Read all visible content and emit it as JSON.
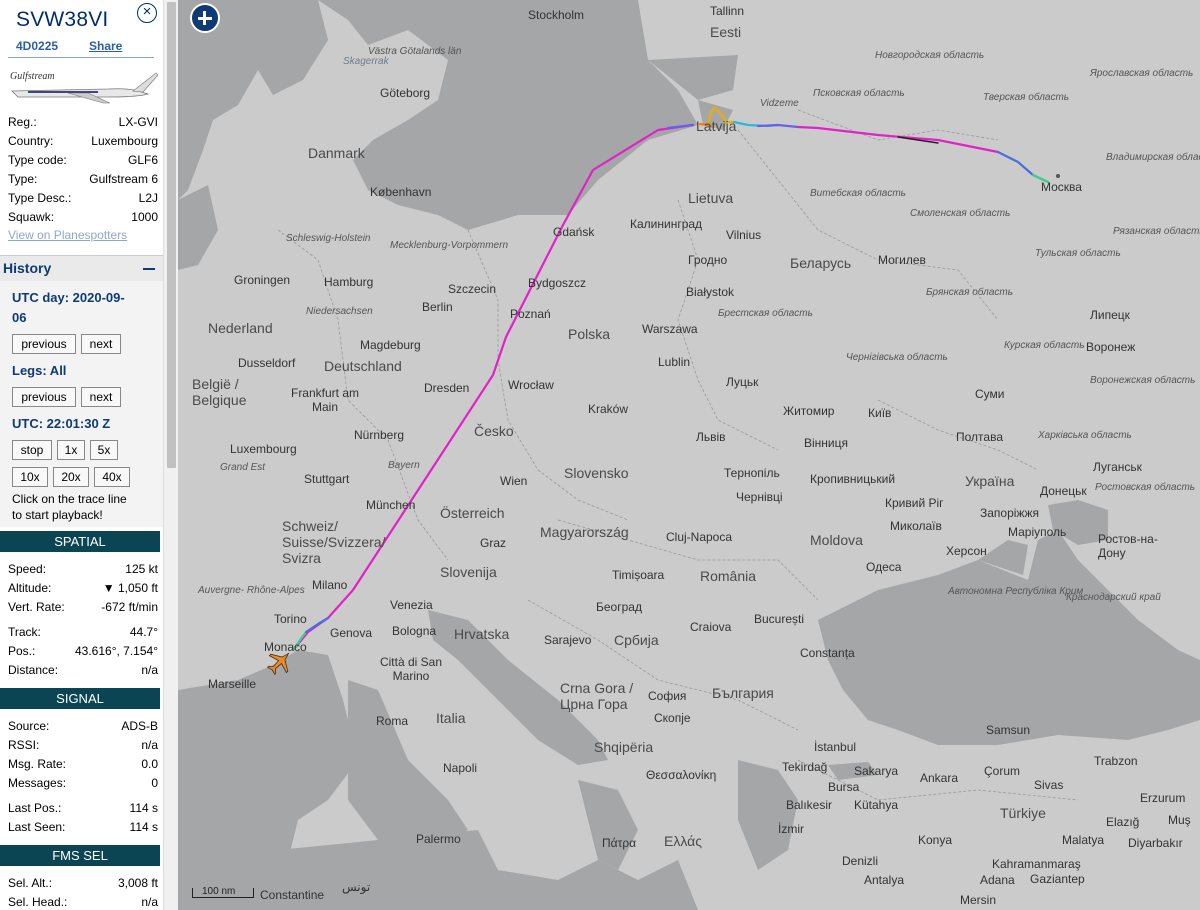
{
  "aircraft": {
    "callsign": "SVW38VI",
    "hex": "4D0225",
    "share_label": "Share",
    "close_icon": "close-icon",
    "photo_brand": "Gulfstream",
    "details": [
      {
        "key": "Reg.:",
        "value": "LX-GVI"
      },
      {
        "key": "Country:",
        "value": "Luxembourg"
      },
      {
        "key": "Type code:",
        "value": "GLF6"
      },
      {
        "key": "Type:",
        "value": "Gulfstream 6"
      },
      {
        "key": "Type Desc.:",
        "value": "L2J"
      },
      {
        "key": "Squawk:",
        "value": "1000"
      }
    ],
    "planespotters_link": "View on Planespotters"
  },
  "history": {
    "title": "History",
    "utc_day": "UTC day: 2020-09-",
    "utc_day_cont": "06",
    "prev_label": "previous",
    "next_label": "next",
    "legs": "Legs: All",
    "utc_time": "UTC: 22:01:30 Z",
    "speed_buttons": [
      "stop",
      "1x",
      "5x",
      "10x",
      "20x",
      "40x"
    ],
    "hint_line1": "Click on the trace line",
    "hint_line2": "to start playback!"
  },
  "spatial": {
    "header": "SPATIAL",
    "rows": [
      {
        "key": "Speed:",
        "value": "125 kt"
      },
      {
        "key": "Altitude:",
        "value": "▼ 1,050 ft"
      },
      {
        "key": "Vert. Rate:",
        "value": "-672 ft/min"
      },
      {
        "key": "Track:",
        "value": "44.7°"
      },
      {
        "key": "Pos.:",
        "value": "43.616°, 7.154°"
      },
      {
        "key": "Distance:",
        "value": "n/a"
      }
    ]
  },
  "signal": {
    "header": "SIGNAL",
    "rows": [
      {
        "key": "Source:",
        "value": "ADS-B"
      },
      {
        "key": "RSSI:",
        "value": "n/a"
      },
      {
        "key": "Msg. Rate:",
        "value": "0.0"
      },
      {
        "key": "Messages:",
        "value": "0"
      },
      {
        "key": "Last Pos.:",
        "value": "114 s"
      },
      {
        "key": "Last Seen:",
        "value": "114 s"
      }
    ]
  },
  "fms": {
    "header": "FMS SEL",
    "rows": [
      {
        "key": "Sel. Alt.:",
        "value": "3,008 ft"
      },
      {
        "key": "Sel. Head.:",
        "value": "n/a"
      }
    ]
  },
  "map": {
    "scale_label": "100 nm",
    "zoom_icon": "plus-icon",
    "aircraft_icon": "airplane-icon",
    "colors": {
      "track": "#e022c8",
      "land": "#cbcbcb",
      "sea": "#a4a6a8",
      "marker": "#f08a1c"
    },
    "labels": {
      "stockholm": "Stockholm",
      "tallinn": "Tallinn",
      "eesti": "Eesti",
      "vastra": "Västra Götalands län",
      "skagerrak": "Skagerrak",
      "goteborg": "Göteborg",
      "danmark": "Danmark",
      "kobenhavn": "København",
      "latvija": "Latvija",
      "vidzeme": "Vidzeme",
      "lietuva": "Lietuva",
      "kaliningrad": "Калининград",
      "vilnius": "Vilnius",
      "gdansk": "Gdańsk",
      "schleswig": "Schleswig-Holstein",
      "mecklenburg": "Mecklenburg-Vorpommern",
      "groningen": "Groningen",
      "hamburg": "Hamburg",
      "szczecin": "Szczecin",
      "bydgoszcz": "Bydgoszcz",
      "berlin": "Berlin",
      "niedersachsen": "Niedersachsen",
      "poznan": "Poznań",
      "polska": "Polska",
      "nederland": "Nederland",
      "magdeburg": "Magdeburg",
      "warszawa": "Warszawa",
      "bialystok": "Białystok",
      "grodno": "Гродно",
      "brest_obl": "Брестская область",
      "belarus": "Беларусь",
      "vitebsk": "Витебская область",
      "mogilev": "Могилев",
      "smolensk": "Смоленская область",
      "moskva": "Москва",
      "pskov": "Псковская область",
      "novgorod": "Новгородская область",
      "tver": "Тверская область",
      "yaroslavl": "Ярославская область",
      "vladimir": "Владимирская область",
      "tula": "Тульская область",
      "ryazan": "Рязанская область",
      "bryansk": "Брянская область",
      "lipetsk": "Липецк",
      "voronezh": "Воронеж",
      "kursk": "Курская область",
      "voronezh_obl": "Воронежская область",
      "dusseldorf": "Dusseldorf",
      "deutschland": "Deutschland",
      "belgie": "België / Belgique",
      "frankfurt": "Frankfurt am Main",
      "dresden": "Dresden",
      "wroclaw": "Wrocław",
      "lublin": "Lublin",
      "lutsk": "Луцьк",
      "zhytomyr": "Житомир",
      "kyiv": "Київ",
      "chernihiv": "Чернігівська область",
      "sumy": "Суми",
      "luxembourg": "Luxembourg",
      "nurnberg": "Nürnberg",
      "cesko": "Česko",
      "krakow": "Kraków",
      "lviv": "Львів",
      "vinnytsia": "Вінниця",
      "poltava": "Полтава",
      "kharkiv": "Харківська область",
      "luhansk": "Луганськ",
      "rostov": "Ростовская область",
      "grandest": "Grand Est",
      "stuttgart": "Stuttgart",
      "bayern": "Bayern",
      "wien": "Wien",
      "slovensko": "Slovensko",
      "ternopil": "Тернопіль",
      "kropyvnytskyi": "Кропивницький",
      "kryvyi": "Кривий Ріг",
      "ukraina": "Україна",
      "donetsk": "Донецьк",
      "chernivtsi": "Чернівці",
      "munchen": "München",
      "osterreich": "Österreich",
      "mykolaiv": "Миколаїв",
      "zaporizhzhia": "Запоріжжя",
      "mariupol": "Маріуполь",
      "schweiz": "Schweiz/ Suisse/Svizzera/ Svizra",
      "graz": "Graz",
      "magyarorszag": "Magyarország",
      "cluj": "Cluj-Napoca",
      "moldova": "Moldova",
      "rostov_don": "Ростов-на- Дону",
      "kherson": "Херсон",
      "odesa": "Одеса",
      "slovenija": "Slovenija",
      "milano": "Milano",
      "timisoara": "Timișoara",
      "romania": "România",
      "krym": "Автономна Республіка Крим",
      "krasnodar": "Краснодарский край",
      "auvergne": "Auvergne- Rhône-Alpes",
      "torino": "Torino",
      "venezia": "Venezia",
      "beograd": "Београд",
      "hrvatska": "Hrvatska",
      "craiova": "Craiova",
      "bucuresti": "București",
      "monaco": "Monaco",
      "genova": "Genova",
      "bologna": "Bologna",
      "sarajevo": "Sarajevo",
      "srbija": "Србија",
      "constanta": "Constanța",
      "citta": "Città di San Marino",
      "marseille": "Marseille",
      "crnagora": "Crna Gora / Црна Гора",
      "sofia": "София",
      "bulgaria": "България",
      "roma": "Roma",
      "italia": "Italia",
      "skopje": "Скопје",
      "shqiperia": "Shqipëria",
      "istanbul": "İstanbul",
      "samsun": "Samsun",
      "tekirdag": "Tekirdağ",
      "sakarya": "Sakarya",
      "ankara": "Ankara",
      "corum": "Çorum",
      "sivas": "Sivas",
      "trabzon": "Trabzon",
      "napoli": "Napoli",
      "thessaloniki": "Θεσσαλονίκη",
      "bursa": "Bursa",
      "balikesir": "Balıkesir",
      "kutahya": "Kütahya",
      "turkiye": "Türkiye",
      "erzurum": "Erzurum",
      "mus": "Muş",
      "elazig": "Elazığ",
      "izmir": "İzmir",
      "konya": "Konya",
      "malatya": "Malatya",
      "diyarbakir": "Diyarbakır",
      "palermo": "Palermo",
      "patra": "Πάτρα",
      "ellada": "Ελλάς",
      "denizli": "Denizli",
      "kahramanmaras": "Kahramanmaraş",
      "antalya": "Antalya",
      "adana": "Adana",
      "mersin": "Mersin",
      "gaziantep": "Gaziantep",
      "tunis": "تونس",
      "constantine": "Constantine"
    }
  }
}
